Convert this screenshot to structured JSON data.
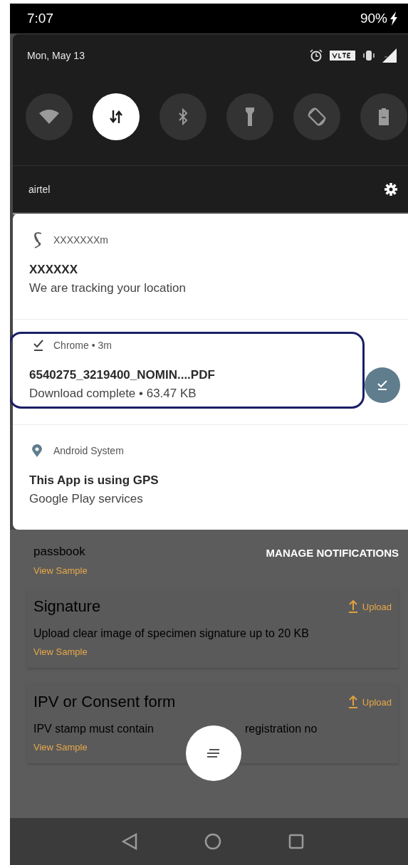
{
  "status_bar": {
    "time": "7:07",
    "battery": "90%",
    "charging": true
  },
  "quick_settings": {
    "date": "Mon, May 13",
    "tiles": [
      {
        "kind": "wifi",
        "on": false
      },
      {
        "kind": "data",
        "on": true
      },
      {
        "kind": "bluetooth",
        "on": false
      },
      {
        "kind": "flashlight",
        "on": false
      },
      {
        "kind": "rotate",
        "on": false
      },
      {
        "kind": "battery_saver",
        "on": false
      }
    ],
    "carrier": "airtel"
  },
  "notifications": [
    {
      "kind": "logo",
      "app": "XXXXXXXm",
      "title": "XXXXXX",
      "text": "We are tracking your location",
      "highlighted": false,
      "action": false
    },
    {
      "kind": "download",
      "app": "Chrome • 3m",
      "title": "6540275_3219400_NOMIN....PDF",
      "text": "Download complete • 63.47 KB",
      "highlighted": true,
      "action": true
    },
    {
      "kind": "location",
      "app": "Android System",
      "title": "This App is using GPS",
      "text": "Google Play services",
      "highlighted": false,
      "action": false
    }
  ],
  "manage_button": "MANAGE NOTIFICATIONS",
  "background_app": {
    "cards": [
      {
        "description": [
          "passbook"
        ],
        "link": "View Sample"
      },
      {
        "title": "Signature",
        "description": [
          "Upload clear image of specimen signature up to 20 KB"
        ],
        "link": "View Sample",
        "action": "Upload"
      },
      {
        "title": "IPV or Consent form",
        "description": [
          "IPV stamp must contain",
          "registration no"
        ],
        "link": "View Sample",
        "action": "Upload"
      }
    ]
  },
  "nav_bar": {
    "buttons": [
      {
        "kind": "back"
      },
      {
        "kind": "home"
      },
      {
        "kind": "recents"
      }
    ]
  }
}
